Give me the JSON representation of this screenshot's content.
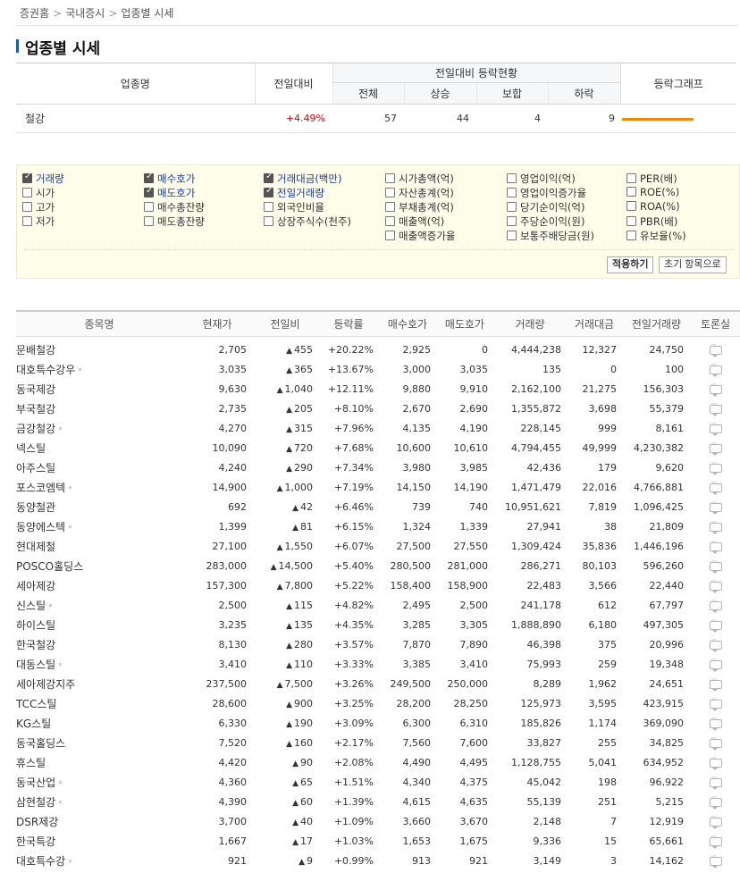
{
  "breadcrumb": [
    "증권홈",
    "국내증시",
    "업종별 시세"
  ],
  "page_title": "업종별 시세",
  "summary": {
    "headers": {
      "name": "업종명",
      "change": "전일대비",
      "group": "전일대비 등락현황",
      "total": "전체",
      "up": "상승",
      "flat": "보합",
      "down": "하락",
      "graph": "등락그래프"
    },
    "row": {
      "name": "철강",
      "change": "+4.49%",
      "total": "57",
      "up": "44",
      "flat": "4",
      "down": "9",
      "up_ratio": 0.772
    }
  },
  "filter": {
    "options": [
      {
        "label": "거래량",
        "checked": true
      },
      {
        "label": "시가",
        "checked": false
      },
      {
        "label": "고가",
        "checked": false
      },
      {
        "label": "저가",
        "checked": false
      },
      {
        "label": "매수호가",
        "checked": true
      },
      {
        "label": "매도호가",
        "checked": true
      },
      {
        "label": "매수총잔량",
        "checked": false
      },
      {
        "label": "매도총잔량",
        "checked": false
      },
      {
        "label": "거래대금(백만)",
        "checked": true
      },
      {
        "label": "전일거래량",
        "checked": true
      },
      {
        "label": "외국인비율",
        "checked": false
      },
      {
        "label": "상장주식수(천주)",
        "checked": false
      },
      {
        "label": "시가총액(억)",
        "checked": false
      },
      {
        "label": "자산총계(억)",
        "checked": false
      },
      {
        "label": "부채총계(억)",
        "checked": false
      },
      {
        "label": "매출액(억)",
        "checked": false
      },
      {
        "label": "매출액증가율",
        "checked": false
      },
      {
        "label": "영업이익(억)",
        "checked": false
      },
      {
        "label": "영업이익증가율",
        "checked": false
      },
      {
        "label": "당기순이익(억)",
        "checked": false
      },
      {
        "label": "주당순이익(원)",
        "checked": false
      },
      {
        "label": "보통주배당금(원)",
        "checked": false
      },
      {
        "label": "PER(배)",
        "checked": false
      },
      {
        "label": "ROE(%)",
        "checked": false
      },
      {
        "label": "ROA(%)",
        "checked": false
      },
      {
        "label": "PBR(배)",
        "checked": false
      },
      {
        "label": "유보율(%)",
        "checked": false
      }
    ],
    "apply_label": "적용하기",
    "reset_label": "초기 항목으로"
  },
  "stocks": {
    "columns": [
      "종목명",
      "현재가",
      "전일비",
      "등락률",
      "매수호가",
      "매도호가",
      "거래량",
      "거래대금",
      "전일거래량",
      "토론실"
    ],
    "rows": [
      {
        "name": "문배철강",
        "star": false,
        "price": "2,705",
        "diff": "455",
        "rate": "+20.22%",
        "bid": "2,925",
        "ask": "0",
        "volume": "4,444,238",
        "amount": "12,327",
        "prev_volume": "24,750"
      },
      {
        "name": "대호특수강우",
        "star": true,
        "price": "3,035",
        "diff": "365",
        "rate": "+13.67%",
        "bid": "3,000",
        "ask": "3,035",
        "volume": "135",
        "amount": "0",
        "prev_volume": "100"
      },
      {
        "name": "동국제강",
        "star": false,
        "price": "9,630",
        "diff": "1,040",
        "rate": "+12.11%",
        "bid": "9,880",
        "ask": "9,910",
        "volume": "2,162,100",
        "amount": "21,275",
        "prev_volume": "156,303"
      },
      {
        "name": "부국철강",
        "star": false,
        "price": "2,735",
        "diff": "205",
        "rate": "+8.10%",
        "bid": "2,670",
        "ask": "2,690",
        "volume": "1,355,872",
        "amount": "3,698",
        "prev_volume": "55,379"
      },
      {
        "name": "금강철강",
        "star": true,
        "price": "4,270",
        "diff": "315",
        "rate": "+7.96%",
        "bid": "4,135",
        "ask": "4,190",
        "volume": "228,145",
        "amount": "999",
        "prev_volume": "8,161"
      },
      {
        "name": "넥스틸",
        "star": false,
        "price": "10,090",
        "diff": "720",
        "rate": "+7.68%",
        "bid": "10,600",
        "ask": "10,610",
        "volume": "4,794,455",
        "amount": "49,999",
        "prev_volume": "4,230,382"
      },
      {
        "name": "아주스틸",
        "star": false,
        "price": "4,240",
        "diff": "290",
        "rate": "+7.34%",
        "bid": "3,980",
        "ask": "3,985",
        "volume": "42,436",
        "amount": "179",
        "prev_volume": "9,620"
      },
      {
        "name": "포스코엠텍",
        "star": true,
        "price": "14,900",
        "diff": "1,000",
        "rate": "+7.19%",
        "bid": "14,150",
        "ask": "14,190",
        "volume": "1,471,479",
        "amount": "22,016",
        "prev_volume": "4,766,881"
      },
      {
        "name": "동양철관",
        "star": false,
        "price": "692",
        "diff": "42",
        "rate": "+6.46%",
        "bid": "739",
        "ask": "740",
        "volume": "10,951,621",
        "amount": "7,819",
        "prev_volume": "1,096,425"
      },
      {
        "name": "동양에스텍",
        "star": true,
        "price": "1,399",
        "diff": "81",
        "rate": "+6.15%",
        "bid": "1,324",
        "ask": "1,339",
        "volume": "27,941",
        "amount": "38",
        "prev_volume": "21,809"
      },
      {
        "name": "현대제철",
        "star": false,
        "price": "27,100",
        "diff": "1,550",
        "rate": "+6.07%",
        "bid": "27,500",
        "ask": "27,550",
        "volume": "1,309,424",
        "amount": "35,836",
        "prev_volume": "1,446,196"
      },
      {
        "name": "POSCO홀딩스",
        "star": false,
        "price": "283,000",
        "diff": "14,500",
        "rate": "+5.40%",
        "bid": "280,500",
        "ask": "281,000",
        "volume": "286,271",
        "amount": "80,103",
        "prev_volume": "596,260"
      },
      {
        "name": "세아제강",
        "star": false,
        "price": "157,300",
        "diff": "7,800",
        "rate": "+5.22%",
        "bid": "158,400",
        "ask": "158,900",
        "volume": "22,483",
        "amount": "3,566",
        "prev_volume": "22,440"
      },
      {
        "name": "신스틸",
        "star": true,
        "price": "2,500",
        "diff": "115",
        "rate": "+4.82%",
        "bid": "2,495",
        "ask": "2,500",
        "volume": "241,178",
        "amount": "612",
        "prev_volume": "67,797"
      },
      {
        "name": "하이스틸",
        "star": false,
        "price": "3,235",
        "diff": "135",
        "rate": "+4.35%",
        "bid": "3,285",
        "ask": "3,305",
        "volume": "1,888,890",
        "amount": "6,180",
        "prev_volume": "497,305"
      },
      {
        "name": "한국철강",
        "star": false,
        "price": "8,130",
        "diff": "280",
        "rate": "+3.57%",
        "bid": "7,870",
        "ask": "7,890",
        "volume": "46,398",
        "amount": "375",
        "prev_volume": "20,996"
      },
      {
        "name": "대동스틸",
        "star": true,
        "price": "3,410",
        "diff": "110",
        "rate": "+3.33%",
        "bid": "3,385",
        "ask": "3,410",
        "volume": "75,993",
        "amount": "259",
        "prev_volume": "19,348"
      },
      {
        "name": "세아제강지주",
        "star": false,
        "price": "237,500",
        "diff": "7,500",
        "rate": "+3.26%",
        "bid": "249,500",
        "ask": "250,000",
        "volume": "8,289",
        "amount": "1,962",
        "prev_volume": "24,651"
      },
      {
        "name": "TCC스틸",
        "star": false,
        "price": "28,600",
        "diff": "900",
        "rate": "+3.25%",
        "bid": "28,200",
        "ask": "28,250",
        "volume": "125,973",
        "amount": "3,595",
        "prev_volume": "423,915"
      },
      {
        "name": "KG스틸",
        "star": false,
        "price": "6,330",
        "diff": "190",
        "rate": "+3.09%",
        "bid": "6,300",
        "ask": "6,310",
        "volume": "185,826",
        "amount": "1,174",
        "prev_volume": "369,090"
      },
      {
        "name": "동국홀딩스",
        "star": false,
        "price": "7,520",
        "diff": "160",
        "rate": "+2.17%",
        "bid": "7,560",
        "ask": "7,600",
        "volume": "33,827",
        "amount": "255",
        "prev_volume": "34,825"
      },
      {
        "name": "휴스틸",
        "star": false,
        "price": "4,420",
        "diff": "90",
        "rate": "+2.08%",
        "bid": "4,490",
        "ask": "4,495",
        "volume": "1,128,755",
        "amount": "5,041",
        "prev_volume": "634,952"
      },
      {
        "name": "동국산업",
        "star": true,
        "price": "4,360",
        "diff": "65",
        "rate": "+1.51%",
        "bid": "4,340",
        "ask": "4,375",
        "volume": "45,042",
        "amount": "198",
        "prev_volume": "96,922"
      },
      {
        "name": "삼현철강",
        "star": true,
        "price": "4,390",
        "diff": "60",
        "rate": "+1.39%",
        "bid": "4,615",
        "ask": "4,635",
        "volume": "55,139",
        "amount": "251",
        "prev_volume": "5,215"
      },
      {
        "name": "DSR제강",
        "star": false,
        "price": "3,700",
        "diff": "40",
        "rate": "+1.09%",
        "bid": "3,660",
        "ask": "3,670",
        "volume": "2,148",
        "amount": "7",
        "prev_volume": "12,919"
      },
      {
        "name": "한국특강",
        "star": false,
        "price": "1,667",
        "diff": "17",
        "rate": "+1.03%",
        "bid": "1,653",
        "ask": "1,675",
        "volume": "9,336",
        "amount": "15",
        "prev_volume": "65,661"
      },
      {
        "name": "대호특수강",
        "star": true,
        "price": "921",
        "diff": "9",
        "rate": "+0.99%",
        "bid": "913",
        "ask": "921",
        "volume": "3,149",
        "amount": "3",
        "prev_volume": "14,162"
      }
    ]
  },
  "colors": {
    "up": "#d6000f",
    "accent": "#1a5bb8",
    "graph_bar": "#f08a00",
    "filter_bg": "#fdfde9"
  },
  "icons": {
    "arrow": "▲",
    "star": "*"
  }
}
